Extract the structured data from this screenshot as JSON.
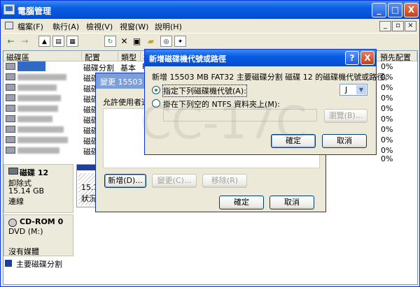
{
  "window": {
    "title": "電腦管理",
    "controls": {
      "minimize": "_",
      "maximize": "□",
      "close": "X"
    },
    "inner_controls": {
      "minimize": "_",
      "restore": "▫",
      "close": "×"
    }
  },
  "menu": [
    "檔案(F)",
    "執行(A)",
    "檢視(V)",
    "視窗(W)",
    "說明(H)"
  ],
  "toolbar": {
    "back": "←",
    "forward": "→",
    "icons": [
      "up-folder-icon",
      "show-tree-icon",
      "properties-icon",
      "refresh-icon",
      "delete-icon",
      "export-icon",
      "open-icon",
      "zoom-icon",
      "wizard-icon"
    ]
  },
  "volume_list": {
    "headers": [
      "磁碟區",
      "配置",
      "類型",
      "檔",
      "預先配置"
    ],
    "rows": [
      {
        "layout": "磁碟分割",
        "type": "基本",
        "fs": "F",
        "percent": "0%",
        "selected": true
      },
      {
        "layout": "磁碟分割",
        "percent": "0%"
      },
      {
        "layout": "磁碟分割",
        "percent": "0%"
      },
      {
        "layout": "磁碟分割",
        "percent": "0%"
      },
      {
        "layout": "磁碟分割",
        "percent": "0%"
      },
      {
        "layout": "磁碟分割",
        "percent": "0%"
      },
      {
        "layout": "磁碟分割",
        "percent": "0%"
      },
      {
        "layout": "磁碟分割",
        "percent": "0%"
      },
      {
        "layout": "磁碟分割",
        "percent": "0%"
      },
      {
        "layout": "磁碟分割",
        "percent": "0%"
      }
    ]
  },
  "disks": [
    {
      "name": "磁碟 12",
      "kind": "卸除式",
      "size": "15.14 GB",
      "status": "連線",
      "partition_size": "15.14",
      "partition_status": "狀況"
    },
    {
      "name": "CD-ROM 0",
      "kind": "DVD (M:)",
      "status": "沒有媒體"
    }
  ],
  "legend": {
    "label": "主要磁碟分割",
    "color": "#1f3f9c"
  },
  "back_dialog": {
    "title": "變更 15503 M",
    "text": "允許使用者透",
    "buttons": {
      "add": "新增(D)...",
      "change": "變更(C)...",
      "remove": "移除(R)",
      "ok": "確定",
      "cancel": "取消"
    }
  },
  "front_dialog": {
    "title": "新增磁碟機代號或路徑",
    "help": "?",
    "close": "X",
    "description": "新增 15503 MB FAT32 主要磁碟分割 磁碟 12 的磁碟機代號或路徑。",
    "option_letter": "指定下列磁碟機代號(A):",
    "drive_letter": "J",
    "option_folder": "掛在下列空的 NTFS 資料夾上(M):",
    "browse": "瀏覽(B)...",
    "ok": "確定",
    "cancel": "取消"
  },
  "watermark": "CC-17C"
}
